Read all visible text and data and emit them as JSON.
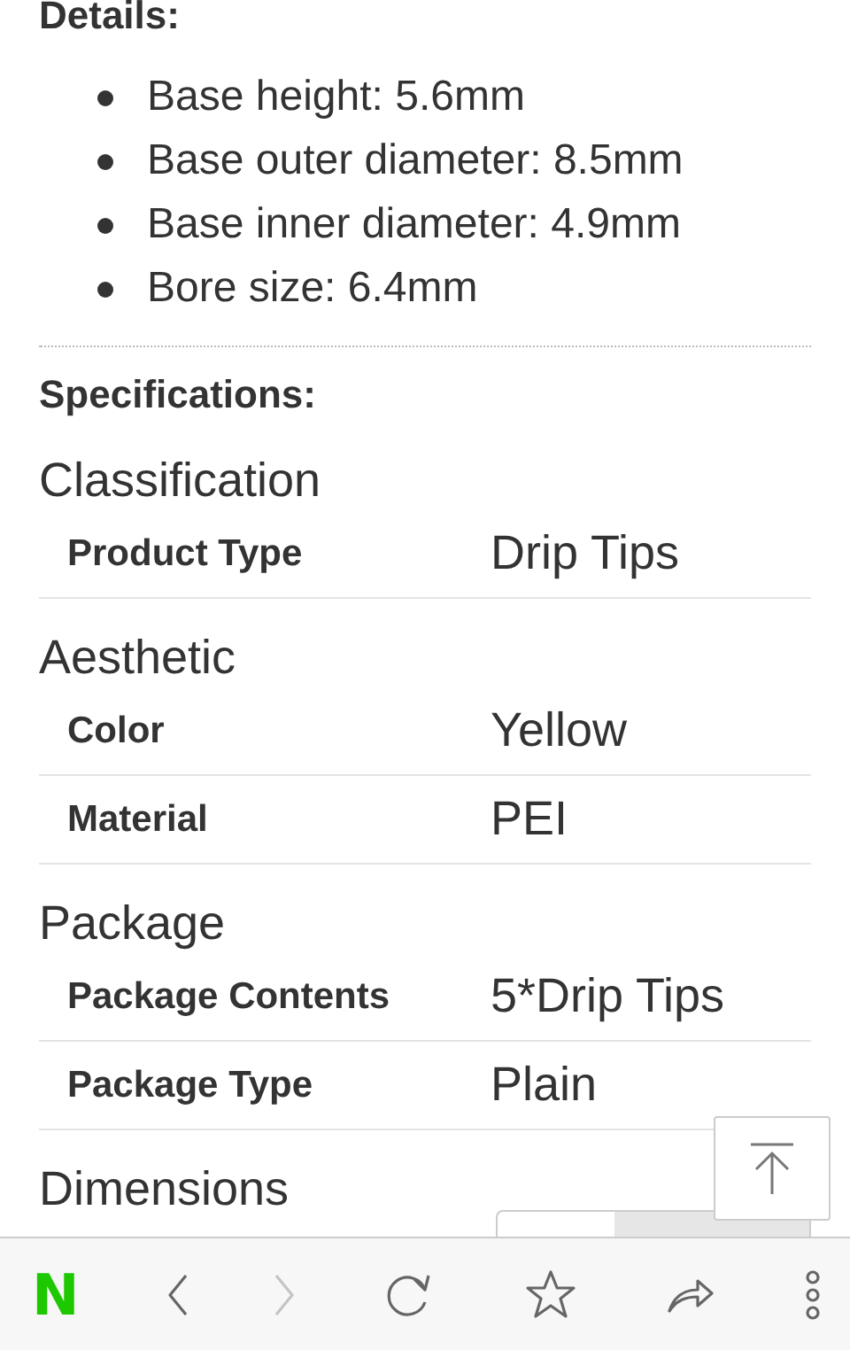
{
  "details": {
    "heading": "Details:",
    "bullets": [
      "Base height: 5.6mm",
      "Base outer diameter: 8.5mm",
      "Base inner diameter: 4.9mm",
      "Bore size: 6.4mm"
    ]
  },
  "specifications": {
    "heading": "Specifications:",
    "groups": [
      {
        "title": "Classification",
        "rows": [
          {
            "label": "Product Type",
            "value": "Drip Tips"
          }
        ]
      },
      {
        "title": "Aesthetic",
        "rows": [
          {
            "label": "Color",
            "value": "Yellow"
          },
          {
            "label": "Material",
            "value": "PEI"
          }
        ]
      },
      {
        "title": "Package",
        "rows": [
          {
            "label": "Package Contents",
            "value": "5*Drip Tips"
          },
          {
            "label": "Package Type",
            "value": "Plain"
          }
        ]
      },
      {
        "title": "Dimensions"
      }
    ]
  },
  "toolbar": {
    "logo": "N",
    "buttons": [
      {
        "kind": "back",
        "disabled": false
      },
      {
        "kind": "forward",
        "disabled": true
      },
      {
        "kind": "reload",
        "disabled": false
      },
      {
        "kind": "bookmark",
        "disabled": false
      },
      {
        "kind": "share",
        "disabled": false
      },
      {
        "kind": "more",
        "disabled": false
      }
    ]
  }
}
